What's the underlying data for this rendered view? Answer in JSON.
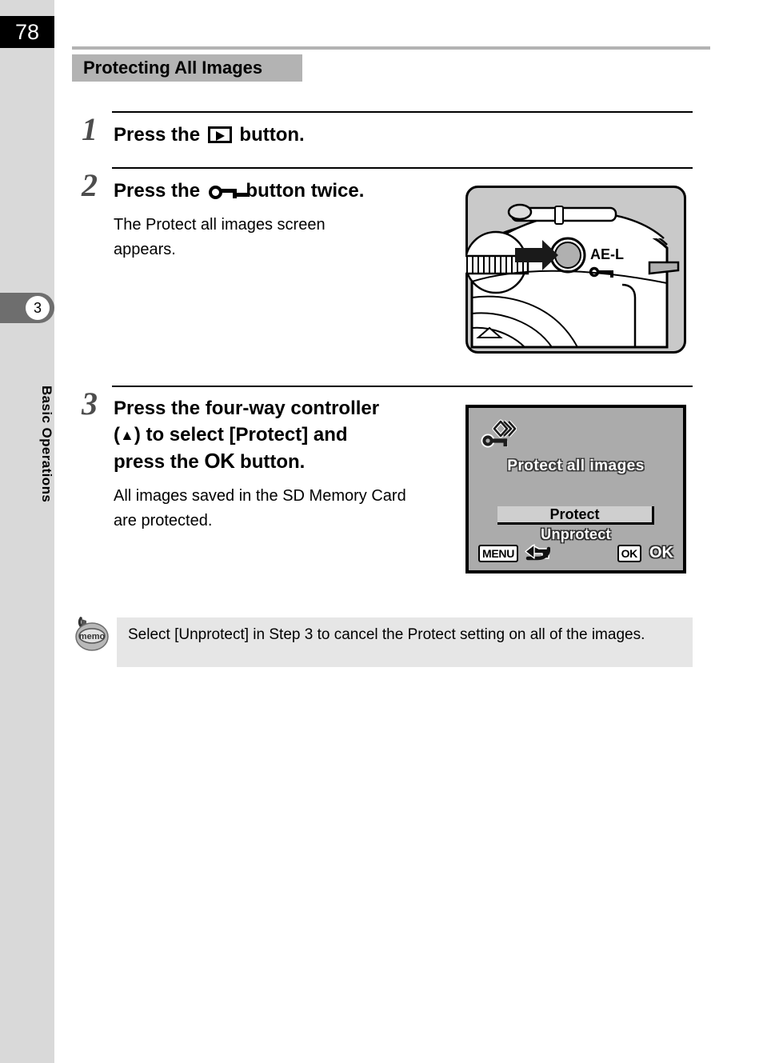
{
  "page": {
    "number": "78",
    "chapter_number": "3",
    "chapter_title": "Basic Operations"
  },
  "section": {
    "heading": "Protecting All Images"
  },
  "steps": [
    {
      "number": "1",
      "heading_pre": "Press the ",
      "icon": "playback-icon",
      "heading_post": " button.",
      "body": ""
    },
    {
      "number": "2",
      "heading_pre": "Press the ",
      "icon": "key-icon",
      "heading_post": " button twice.",
      "body": "The Protect all images screen appears."
    },
    {
      "number": "3",
      "heading_line1": "Press the four-way controller",
      "heading_line2_pre": "(",
      "heading_line2_arrow": "▲",
      "heading_line2_post": ") to select [Protect] and",
      "heading_line3_pre": "press the ",
      "heading_line3_ok": "OK",
      "heading_line3_post": " button.",
      "body": "All images saved in the SD Memory Card are protected."
    }
  ],
  "camera_figure": {
    "button_label": "AE-L",
    "button_icon": "key-icon",
    "arrow_icon": "right-arrow-icon",
    "dial_icon": "e-dial-icon",
    "alt": "camera-top-right-illustration"
  },
  "lcd_screen": {
    "icon": "protect-all-images-key-icon",
    "title": "Protect all images",
    "options": [
      {
        "label": "Protect",
        "selected": true
      },
      {
        "label": "Unprotect",
        "selected": false
      }
    ],
    "footer": {
      "menu_badge": "MENU",
      "back_icon": "back-arrow-icon",
      "ok_badge": "OK",
      "ok_label": "OK"
    },
    "background_color": "#ababab",
    "highlight_color": "#cfcfcf"
  },
  "memo": {
    "icon_label": "memo",
    "text": "Select [Unprotect] in Step 3 to cancel the Protect setting on all of the images."
  }
}
